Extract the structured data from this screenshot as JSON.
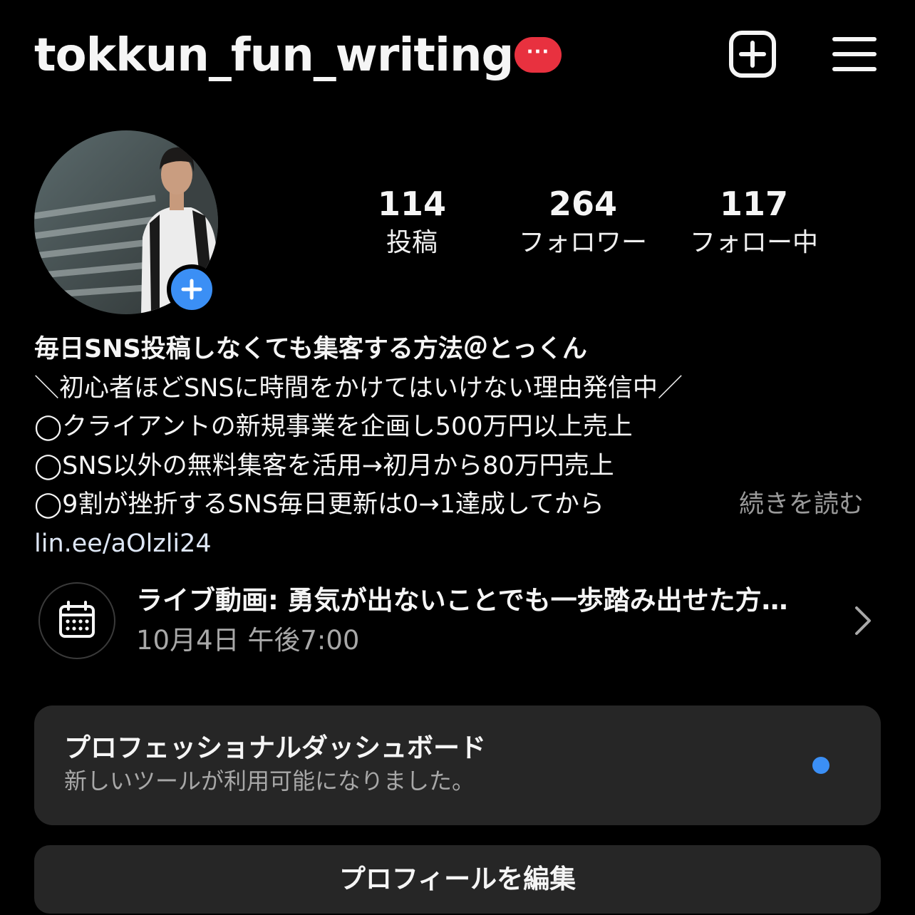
{
  "header": {
    "username": "tokkun_fun_writing",
    "badge_label": "···",
    "new_post_icon": "plus-square-icon",
    "menu_icon": "hamburger-menu-icon"
  },
  "profile": {
    "avatar_icon": "profile-photo",
    "add_story_icon": "plus-icon",
    "stats": {
      "posts": {
        "value": "114",
        "label": "投稿"
      },
      "followers": {
        "value": "264",
        "label": "フォロワー"
      },
      "following": {
        "value": "117",
        "label": "フォロー中"
      }
    }
  },
  "bio": {
    "name": "毎日SNS投稿しなくても集客する方法＠とっくん",
    "lines": [
      "＼初心者ほどSNSに時間をかけてはいけない理由発信中／",
      "◯クライアントの新規事業を企画し500万円以上売上",
      "◯SNS以外の無料集客を活用→初月から80万円売上",
      "◯9割が挫折するSNS毎日更新は0→1達成してから"
    ],
    "read_more": "続きを読む",
    "link": "lin.ee/aOlzli24"
  },
  "event": {
    "icon": "calendar-icon",
    "title": "ライブ動画: 勇気が出ないことでも一歩踏み出せた方…",
    "time": "10月4日 午後7:00",
    "chevron_icon": "chevron-right-icon"
  },
  "dashboard": {
    "title": "プロフェッショナルダッシュボード",
    "subtitle": "新しいツールが利用可能になりました。",
    "dot_color": "#3b8ff5"
  },
  "actions": {
    "edit_profile": "プロフィールを編集"
  },
  "colors": {
    "background": "#000000",
    "card": "#262626",
    "accent_blue": "#3b8ff5",
    "badge_red": "#e8313f",
    "muted_text": "#a8a8a8"
  }
}
